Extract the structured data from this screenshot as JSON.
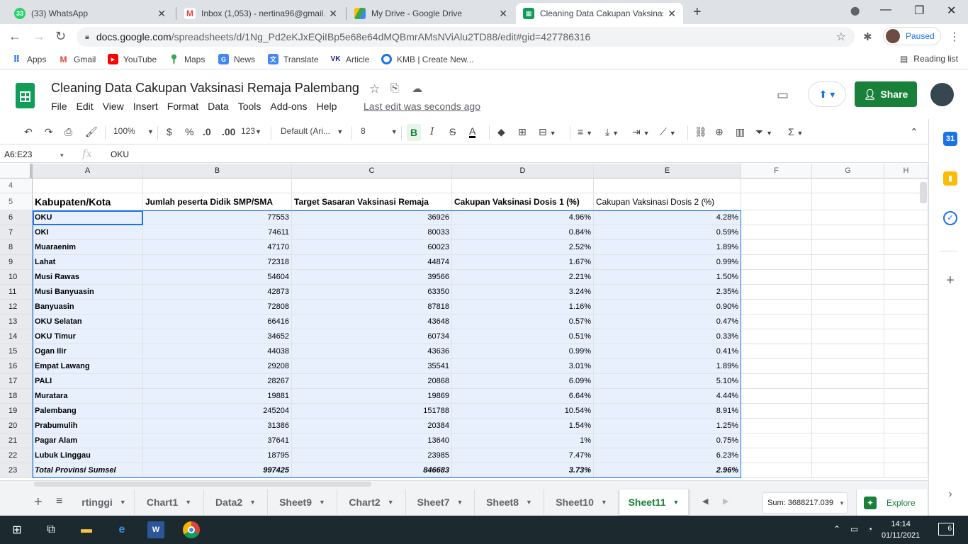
{
  "browser": {
    "tabs": [
      {
        "label": "(33) WhatsApp",
        "badge": "33"
      },
      {
        "label": "Inbox (1,053) - nertina96@gmail."
      },
      {
        "label": "My Drive - Google Drive"
      },
      {
        "label": "Cleaning Data Cakupan Vaksinasi"
      }
    ],
    "url_host": "docs.google.com",
    "url_path": "/spreadsheets/d/1Ng_Pd2eKJxEQiIBp5e68e64dMQBmrAMsNViAlu2TD88/edit#gid=427786316",
    "profile_status": "Paused",
    "bookmarks": [
      "Apps",
      "Gmail",
      "YouTube",
      "Maps",
      "News",
      "Translate",
      "Article",
      "KMB | Create New..."
    ],
    "reading_list": "Reading list"
  },
  "doc": {
    "title": "Cleaning Data Cakupan Vaksinasi Remaja Palembang",
    "menu": [
      "File",
      "Edit",
      "View",
      "Insert",
      "Format",
      "Data",
      "Tools",
      "Add-ons",
      "Help"
    ],
    "last_edit": "Last edit was seconds ago",
    "share": "Share"
  },
  "toolbar": {
    "zoom": "100%",
    "currency": "$",
    "percent": "%",
    "dec_less": ".0",
    "dec_more": ".00",
    "num_format": "123",
    "font": "Default (Ari...",
    "font_size": "8"
  },
  "formula_bar": {
    "name_box": "A6:E23",
    "fx": "fx",
    "value": "OKU"
  },
  "columns": [
    "A",
    "B",
    "C",
    "D",
    "E",
    "F",
    "G",
    "H"
  ],
  "row_numbers": [
    "4",
    "5",
    "6",
    "7",
    "8",
    "9",
    "10",
    "11",
    "12",
    "13",
    "14",
    "15",
    "16",
    "17",
    "18",
    "19",
    "20",
    "21",
    "22",
    "23"
  ],
  "table": {
    "headers": [
      "Kabupaten/Kota",
      "Jumlah peserta Didik SMP/SMA",
      "Target Sasaran Vaksinasi Remaja",
      "Cakupan Vaksinasi Dosis 1 (%)",
      "Cakupan Vaksinasi  Dosis 2 (%)"
    ],
    "rows": [
      [
        "OKU",
        "77553",
        "36926",
        "4.96%",
        "4.28%"
      ],
      [
        "OKI",
        "74611",
        "80033",
        "0.84%",
        "0.59%"
      ],
      [
        "Muaraenim",
        "47170",
        "60023",
        "2.52%",
        "1.89%"
      ],
      [
        "Lahat",
        "72318",
        "44874",
        "1.67%",
        "0.99%"
      ],
      [
        "Musi Rawas",
        "54604",
        "39566",
        "2.21%",
        "1.50%"
      ],
      [
        "Musi Banyuasin",
        "42873",
        "63350",
        "3.24%",
        "2.35%"
      ],
      [
        "Banyuasin",
        "72808",
        "87818",
        "1.16%",
        "0.90%"
      ],
      [
        "OKU Selatan",
        "66416",
        "43648",
        "0.57%",
        "0.47%"
      ],
      [
        "OKU Timur",
        "34652",
        "60734",
        "0.51%",
        "0.33%"
      ],
      [
        "Ogan Ilir",
        "44038",
        "43636",
        "0.99%",
        "0.41%"
      ],
      [
        "Empat Lawang",
        "29208",
        "35541",
        "3.01%",
        "1.89%"
      ],
      [
        "PALI",
        "28267",
        "20868",
        "6.09%",
        "5.10%"
      ],
      [
        "Muratara",
        "19881",
        "19869",
        "6.64%",
        "4.44%"
      ],
      [
        "Palembang",
        "245204",
        "151788",
        "10.54%",
        "8.91%"
      ],
      [
        "Prabumulih",
        "31386",
        "20384",
        "1.54%",
        "1.25%"
      ],
      [
        "Pagar Alam",
        "37641",
        "13640",
        "1%",
        "0.75%"
      ],
      [
        "Lubuk Linggau",
        "18795",
        "23985",
        "7.47%",
        "6.23%"
      ]
    ],
    "total": [
      "Total Provinsi Sumsel",
      "997425",
      "846683",
      "3.73%",
      "2.96%"
    ]
  },
  "sheet_tabs": [
    "rtinggi",
    "Chart1",
    "Data2",
    "Sheet9",
    "Chart2",
    "Sheet7",
    "Sheet8",
    "Sheet10",
    "Sheet11"
  ],
  "active_sheet": "Sheet11",
  "sum_status": "Sum: 3688217.039",
  "explore": "Explore",
  "taskbar": {
    "time": "14:14",
    "date": "01/11/2021",
    "notifications": "6"
  },
  "colors": {
    "accent": "#1a73e8",
    "sheets_green": "#188038",
    "selection_fill": "#e8f0fe"
  }
}
